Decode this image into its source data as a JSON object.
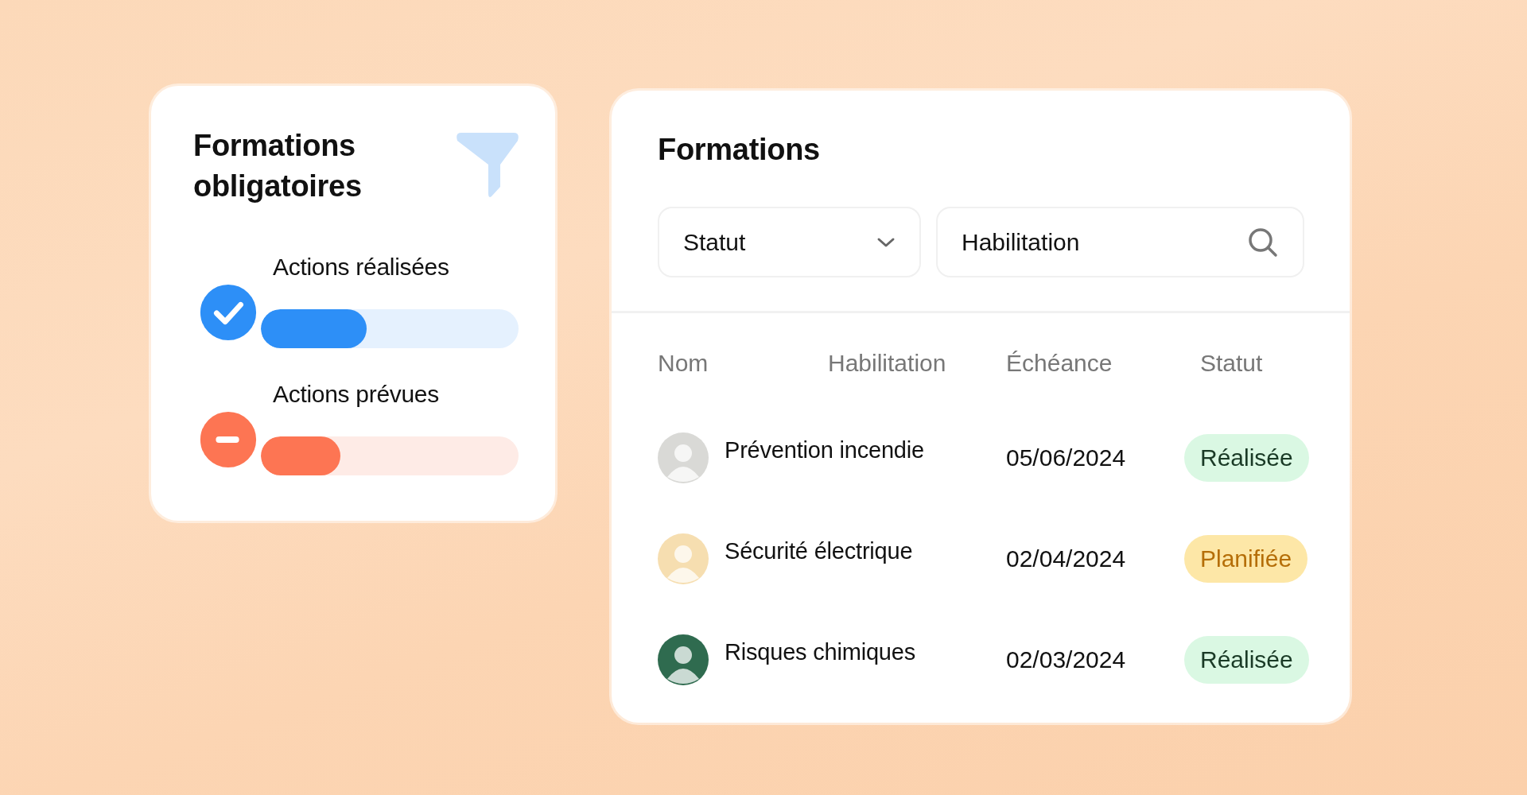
{
  "summary_card": {
    "title": "Formations obligatoires",
    "progress": [
      {
        "label": "Actions réalisées",
        "kind": "done",
        "level": 0.41
      },
      {
        "label": "Actions prévues",
        "kind": "planned",
        "level": 0.31
      }
    ]
  },
  "trainings_card": {
    "title": "Formations",
    "status_filter": {
      "value": "Statut"
    },
    "search": {
      "value": "Habilitation"
    },
    "table": {
      "columns": [
        "Nom",
        "Habilitation",
        "Échéance",
        "Statut"
      ],
      "rows": [
        {
          "name": "Prévention incendie",
          "date": "05/06/2024",
          "color": "#d9d9d6",
          "status": {
            "label": "Réalisée",
            "kind": "done"
          }
        },
        {
          "name": "Sécurité électrique",
          "date": "02/04/2024",
          "color": "#f6deb0",
          "status": {
            "label": "Planifiée",
            "kind": "planned"
          }
        },
        {
          "name": "Risques chimiques",
          "date": "02/03/2024",
          "color": "#2f6b4f",
          "status": {
            "label": "Réalisée",
            "kind": "done"
          }
        }
      ]
    }
  }
}
